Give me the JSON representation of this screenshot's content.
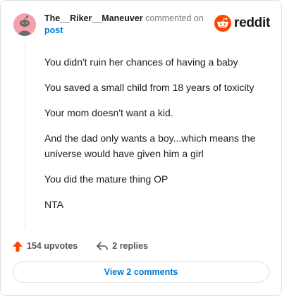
{
  "header": {
    "username": "The__Riker__Maneuver",
    "action_text": "commented on",
    "post_link": "post",
    "brand": "reddit"
  },
  "comment": {
    "paragraphs": [
      "You didn't ruin her chances of having a baby",
      "You saved a small child from 18 years of toxicity",
      "Your mom doesn't want a kid.",
      "And the dad only wants a boy...which means the universe would have given him a girl",
      "You did the mature thing OP",
      "NTA"
    ]
  },
  "footer": {
    "upvotes": "154 upvotes",
    "replies": "2 replies",
    "view_comments": "View 2 comments"
  },
  "colors": {
    "accent": "#0079d3",
    "upvote": "#ff4500",
    "reddit_orange": "#ff4500",
    "avatar_bg": "#f4a0ad"
  },
  "icons": {
    "avatar": "snoo-avatar-icon",
    "brand": "reddit-logo-icon",
    "upvote": "upvote-arrow-icon",
    "reply": "reply-arrow-icon"
  }
}
